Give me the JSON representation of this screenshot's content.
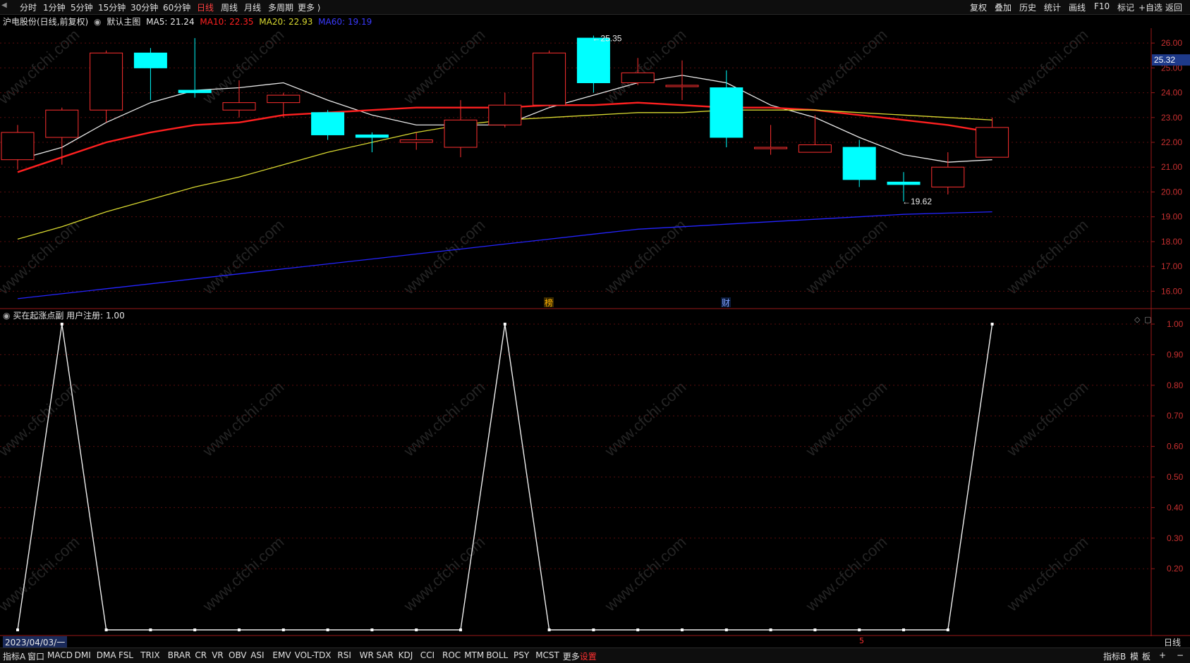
{
  "topbar": {
    "left_items": [
      "分时",
      "1分钟",
      "5分钟",
      "15分钟",
      "30分钟",
      "60分钟",
      "日线",
      "周线",
      "月线",
      "多周期",
      "更多 ⟩"
    ],
    "active": "日线",
    "right_items": [
      "复权",
      "叠加",
      "历史",
      "统计",
      "画线",
      "F10",
      "标记",
      "+自选",
      "返回"
    ]
  },
  "legend": {
    "stock": "沪电股份(日线,前复权)",
    "template": "默认主图",
    "ma5": "MA5: 21.24",
    "ma10": "MA10: 22.35",
    "ma20": "MA20: 22.93",
    "ma60": "MA60: 19.19"
  },
  "colors": {
    "ma5": "#e8e8e8",
    "ma10": "#ff2020",
    "ma20": "#d8d830",
    "ma60": "#2424ff",
    "up": "#ff3030",
    "down": "#00ffff",
    "axis": "#9a1818",
    "grid": "#5a0e0e"
  },
  "price_axis": {
    "ticks": [
      "26.00",
      "25.00",
      "24.00",
      "23.00",
      "22.00",
      "21.00",
      "20.00",
      "19.00",
      "18.00",
      "17.00",
      "16.00"
    ],
    "current": "25.32",
    "high_label": "25.35",
    "low_label": "19.62"
  },
  "markers": {
    "bang": "榜",
    "cai": "财"
  },
  "indicator": {
    "label": "买在起涨点副  用户注册: 1.00",
    "ticks": [
      "1.00",
      "0.90",
      "0.80",
      "0.70",
      "0.60",
      "0.50",
      "0.40",
      "0.30",
      "0.20"
    ]
  },
  "date_strip": {
    "date": "2023/04/03/一",
    "marker": "5",
    "period": "日线"
  },
  "bottombar": {
    "items": [
      "指标A",
      "窗口",
      "MACD",
      "DMI",
      "DMA",
      "FSL",
      "TRIX",
      "BRAR",
      "CR",
      "VR",
      "OBV",
      "ASI",
      "EMV",
      "VOL-TDX",
      "RSI",
      "WR",
      "SAR",
      "KDJ",
      "CCI",
      "ROC",
      "MTM",
      "BOLL",
      "PSY",
      "MCST",
      "更多",
      "设置"
    ],
    "right_items": [
      "指标B",
      "模",
      "板",
      "+",
      "−"
    ]
  },
  "chart_data": [
    {
      "type": "candlestick",
      "title": "沪电股份(日线,前复权)",
      "ylim": [
        15.3,
        26.6
      ],
      "candles": [
        {
          "o": 21.3,
          "h": 22.7,
          "l": 20.9,
          "c": 22.4
        },
        {
          "o": 22.2,
          "h": 23.4,
          "l": 21.1,
          "c": 23.3
        },
        {
          "o": 23.3,
          "h": 25.7,
          "l": 22.8,
          "c": 25.6
        },
        {
          "o": 25.6,
          "h": 25.8,
          "l": 23.7,
          "c": 25.0
        },
        {
          "o": 24.1,
          "h": 26.2,
          "l": 23.8,
          "c": 24.0
        },
        {
          "o": 23.3,
          "h": 24.5,
          "l": 23.0,
          "c": 23.6
        },
        {
          "o": 23.6,
          "h": 24.0,
          "l": 23.0,
          "c": 23.9
        },
        {
          "o": 23.2,
          "h": 23.3,
          "l": 22.1,
          "c": 22.3
        },
        {
          "o": 22.3,
          "h": 22.4,
          "l": 21.6,
          "c": 22.2
        },
        {
          "o": 22.0,
          "h": 22.4,
          "l": 21.7,
          "c": 22.1
        },
        {
          "o": 21.8,
          "h": 23.7,
          "l": 21.4,
          "c": 22.9
        },
        {
          "o": 22.7,
          "h": 24.0,
          "l": 22.6,
          "c": 23.5
        },
        {
          "o": 23.5,
          "h": 25.7,
          "l": 23.4,
          "c": 25.6
        },
        {
          "o": 26.2,
          "h": 26.3,
          "l": 24.0,
          "c": 24.4
        },
        {
          "o": 24.4,
          "h": 25.4,
          "l": 24.3,
          "c": 24.8
        },
        {
          "o": 24.3,
          "h": 25.3,
          "l": 23.7,
          "c": 24.3
        },
        {
          "o": 24.2,
          "h": 24.9,
          "l": 21.8,
          "c": 22.2
        },
        {
          "o": 21.8,
          "h": 22.7,
          "l": 21.5,
          "c": 21.8
        },
        {
          "o": 21.6,
          "h": 23.1,
          "l": 21.6,
          "c": 21.9
        },
        {
          "o": 21.8,
          "h": 22.1,
          "l": 20.2,
          "c": 20.5
        },
        {
          "o": 20.4,
          "h": 20.8,
          "l": 19.62,
          "c": 20.3
        },
        {
          "o": 20.2,
          "h": 21.6,
          "l": 19.9,
          "c": 21.0
        },
        {
          "o": 21.4,
          "h": 23.0,
          "l": 21.4,
          "c": 22.6
        }
      ],
      "series": [
        {
          "name": "MA5",
          "values": [
            21.3,
            21.8,
            22.8,
            23.6,
            24.1,
            24.2,
            24.4,
            23.7,
            23.1,
            22.7,
            22.7,
            22.7,
            23.4,
            23.9,
            24.4,
            24.7,
            24.4,
            23.5,
            23.0,
            22.2,
            21.5,
            21.2,
            21.3
          ]
        },
        {
          "name": "MA10",
          "values": [
            20.8,
            21.4,
            22.0,
            22.4,
            22.7,
            22.8,
            23.1,
            23.2,
            23.3,
            23.4,
            23.4,
            23.4,
            23.5,
            23.5,
            23.6,
            23.5,
            23.4,
            23.4,
            23.3,
            23.1,
            22.9,
            22.7,
            22.4
          ]
        },
        {
          "name": "MA20",
          "values": [
            18.1,
            18.6,
            19.2,
            19.7,
            20.2,
            20.6,
            21.1,
            21.6,
            22.0,
            22.4,
            22.7,
            22.9,
            23.0,
            23.1,
            23.2,
            23.2,
            23.3,
            23.3,
            23.3,
            23.2,
            23.1,
            23.0,
            22.9
          ]
        },
        {
          "name": "MA60",
          "values": [
            15.7,
            15.9,
            16.1,
            16.3,
            16.5,
            16.7,
            16.9,
            17.1,
            17.3,
            17.5,
            17.7,
            17.9,
            18.1,
            18.3,
            18.5,
            18.6,
            18.7,
            18.8,
            18.9,
            19.0,
            19.1,
            19.15,
            19.2
          ]
        }
      ]
    },
    {
      "type": "line",
      "title": "买在起涨点副",
      "ylim": [
        0,
        1.0
      ],
      "values": [
        0,
        1,
        0,
        0,
        0,
        0,
        0,
        0,
        0,
        0,
        0,
        1,
        0,
        0,
        0,
        0,
        0,
        0,
        0,
        0,
        0,
        0,
        1
      ]
    }
  ]
}
